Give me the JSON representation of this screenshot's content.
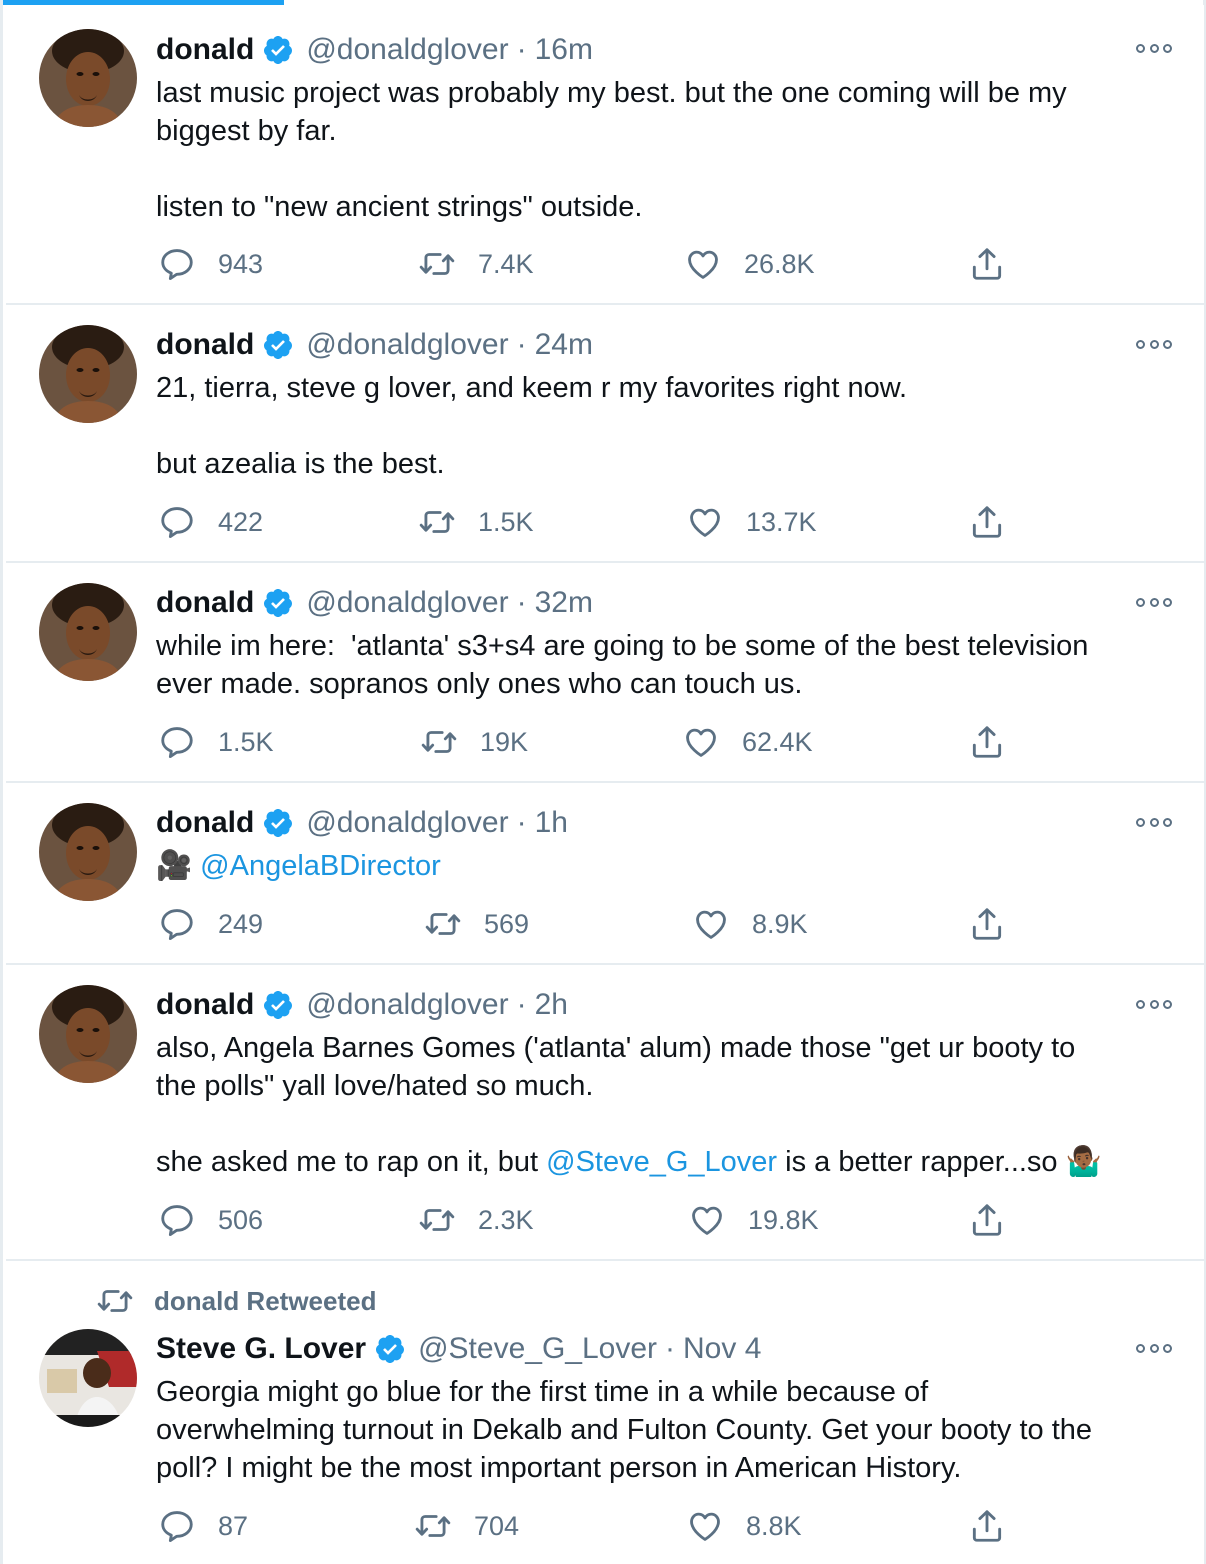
{
  "colors": {
    "accent": "#1da1f2",
    "mention": "#1b95e0",
    "secondary": "#5b7083",
    "divider": "#e6ecf0"
  },
  "tweets": [
    {
      "name": "donald",
      "handle": "@donaldglover",
      "dot": "·",
      "time": "16m",
      "lines": [
        "last music project was probably my best. but the one coming will be my",
        "biggest by far."
      ],
      "lines2": [
        "listen to \"new ancient strings\" outside."
      ],
      "replies": "943",
      "retweets": "7.4K",
      "likes": "26.8K"
    },
    {
      "name": "donald",
      "handle": "@donaldglover",
      "dot": "·",
      "time": "24m",
      "lines": [
        "21, tierra, steve g lover, and keem r my favorites right now."
      ],
      "lines2": [
        "but azealia is the best."
      ],
      "replies": "422",
      "retweets": "1.5K",
      "likes": "13.7K"
    },
    {
      "name": "donald",
      "handle": "@donaldglover",
      "dot": "·",
      "time": "32m",
      "lines": [
        "while im here:  'atlanta' s3+s4 are going to be some of the best television",
        "ever made. sopranos only ones who can touch us."
      ],
      "replies": "1.5K",
      "retweets": "19K",
      "likes": "62.4K"
    },
    {
      "name": "donald",
      "handle": "@donaldglover",
      "dot": "·",
      "time": "1h",
      "emoji": "🎥",
      "mention": "@AngelaBDirector",
      "replies": "249",
      "retweets": "569",
      "likes": "8.9K"
    },
    {
      "name": "donald",
      "handle": "@donaldglover",
      "dot": "·",
      "time": "2h",
      "lines": [
        "also, Angela Barnes Gomes ('atlanta' alum) made those \"get ur booty to",
        "the polls\" yall love/hated so much."
      ],
      "last_pre": "she asked me to rap on it, but ",
      "last_mention": "@Steve_G_Lover",
      "last_post": " is a better rapper...so ",
      "last_emoji": "🤷🏾‍♂️",
      "replies": "506",
      "retweets": "2.3K",
      "likes": "19.8K"
    },
    {
      "context": "donald Retweeted",
      "name": "Steve G. Lover",
      "handle": "@Steve_G_Lover",
      "dot": "·",
      "time": "Nov 4",
      "lines": [
        "Georgia might go blue for the first time in a while because of",
        "overwhelming turnout in Dekalb and Fulton County. Get your booty to the",
        "poll? I might be the most important person in American History."
      ],
      "replies": "87",
      "retweets": "704",
      "likes": "8.8K"
    }
  ]
}
